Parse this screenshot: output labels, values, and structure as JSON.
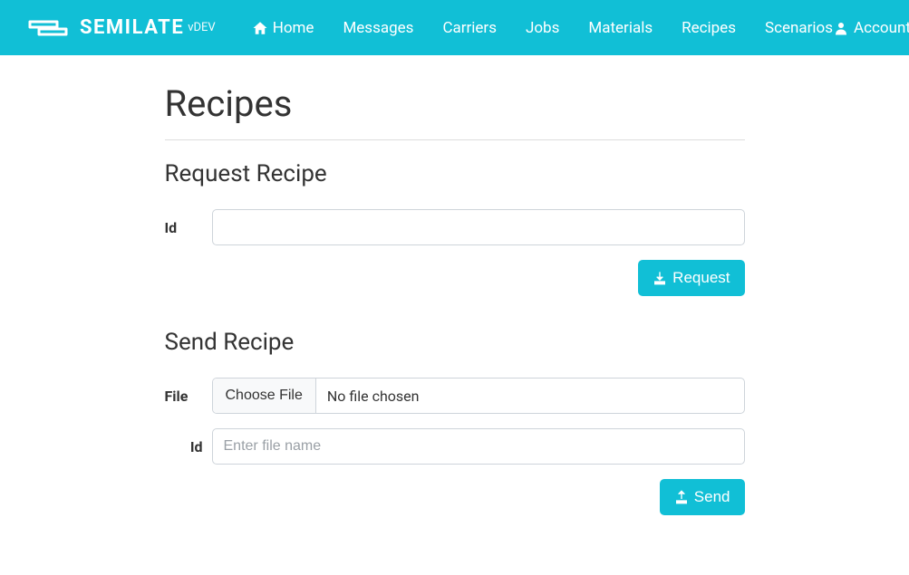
{
  "brand": {
    "name": "SEMILATE",
    "version": "vDEV"
  },
  "nav": {
    "home": "Home",
    "messages": "Messages",
    "carriers": "Carriers",
    "jobs": "Jobs",
    "materials": "Materials",
    "recipes": "Recipes",
    "scenarios": "Scenarios",
    "account": "Account"
  },
  "page": {
    "title": "Recipes"
  },
  "request": {
    "title": "Request Recipe",
    "id_label": "Id",
    "id_value": "",
    "button": "Request"
  },
  "send": {
    "title": "Send Recipe",
    "file_label": "File",
    "choose_file": "Choose File",
    "no_file": "No file chosen",
    "id_label": "Id",
    "id_placeholder": "Enter file name",
    "id_value": "",
    "button": "Send"
  }
}
